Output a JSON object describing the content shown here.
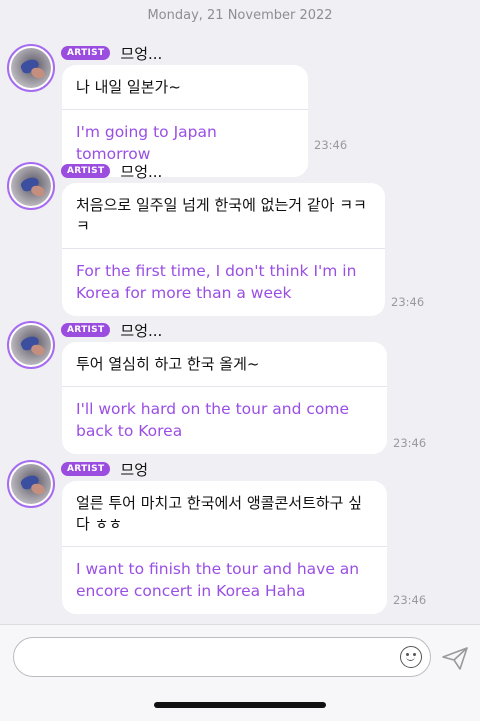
{
  "date": "Monday, 21 November 2022",
  "messages": [
    {
      "badge": "ARTIST",
      "sender": "므엉...",
      "korean": "나 내일 일본가~",
      "english": "I'm going to Japan tomorrow",
      "time": "23:46"
    },
    {
      "badge": "ARTIST",
      "sender": "므엉...",
      "korean": "처음으로 일주일 넘게 한국에 없는거 같아 ㅋㅋㅋ",
      "english": "For the first time, I don't think I'm in Korea for more than a week",
      "time": "23:46"
    },
    {
      "badge": "ARTIST",
      "sender": "므엉...",
      "korean": "투어 열심히 하고 한국 올게~",
      "english": "I'll work hard on the tour and come back to Korea",
      "time": "23:46"
    },
    {
      "badge": "ARTIST",
      "sender": "므엉",
      "korean": "얼른 투어 마치고 한국에서 앵콜콘서트하구 싶다 ㅎㅎ",
      "english": "I want to finish the tour and have an encore concert in Korea Haha",
      "time": "23:46"
    }
  ],
  "input": {
    "placeholder": ""
  },
  "icons": {
    "emoji": "emoji-icon",
    "send": "send-icon"
  },
  "colors": {
    "accent": "#9b4de0",
    "translation_text": "#9a4fe4",
    "background": "#f0eff4"
  }
}
